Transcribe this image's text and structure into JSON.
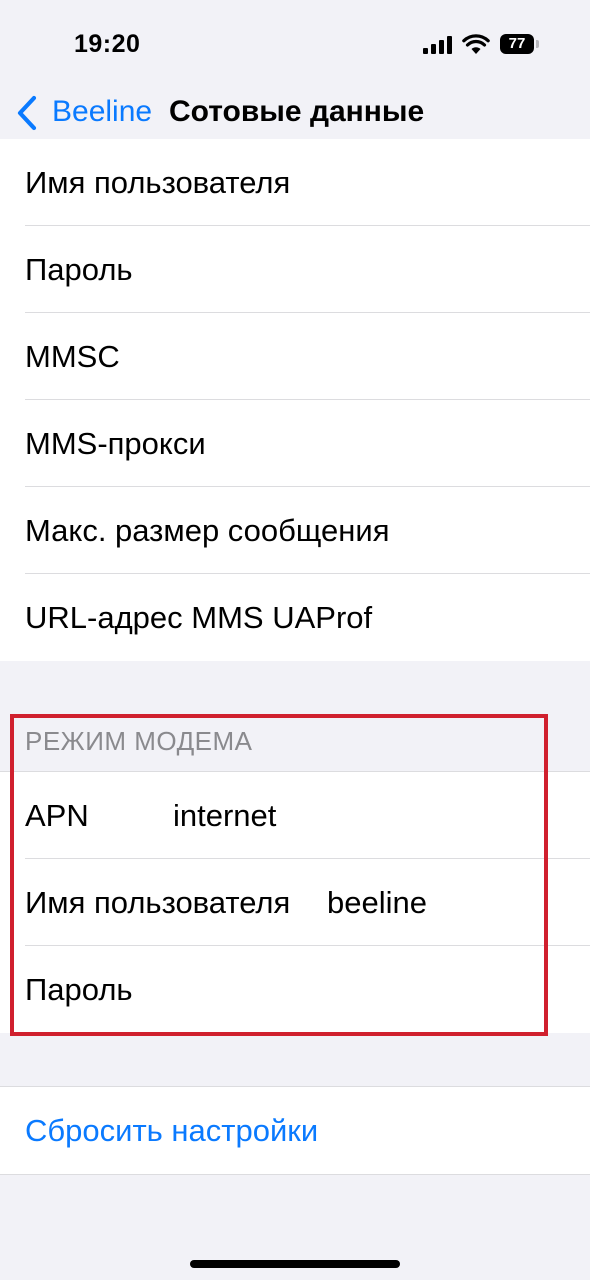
{
  "status": {
    "time": "19:20",
    "battery": "77"
  },
  "nav": {
    "back_label": "Beeline",
    "title": "Сотовые данные"
  },
  "mms_section": {
    "rows": [
      {
        "label": "Имя пользователя"
      },
      {
        "label": "Пароль"
      },
      {
        "label": "MMSC"
      },
      {
        "label": "MMS-прокси"
      },
      {
        "label": "Макс. размер сообщения"
      },
      {
        "label": "URL-адрес MMS UAProf"
      }
    ]
  },
  "modem_section": {
    "header": "РЕЖИМ МОДЕМА",
    "rows": [
      {
        "label": "APN",
        "value": "internet"
      },
      {
        "label": "Имя пользователя",
        "value": "beeline"
      },
      {
        "label": "Пароль",
        "value": ""
      }
    ]
  },
  "reset": {
    "label": "Сбросить настройки"
  },
  "colors": {
    "accent": "#0a7aff",
    "highlight": "#d0202e",
    "background": "#f2f2f7"
  }
}
